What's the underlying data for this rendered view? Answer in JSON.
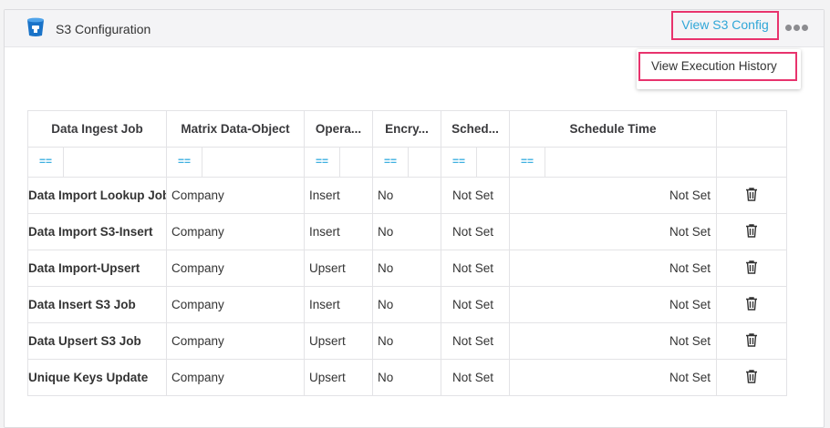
{
  "header": {
    "title": "S3 Configuration",
    "view_config_label": "View S3 Config"
  },
  "menu": {
    "items": [
      "View Execution History"
    ]
  },
  "table": {
    "columns": [
      "Data Ingest Job",
      "Matrix Data-Object",
      "Opera...",
      "Encry...",
      "Sched...",
      "Schedule Time",
      ""
    ],
    "filter_icon": "==",
    "rows": [
      [
        "Data Import Lookup Job",
        "Company",
        "Insert",
        "No",
        "Not Set",
        "Not Set"
      ],
      [
        "Data Import S3-Insert",
        "Company",
        "Insert",
        "No",
        "Not Set",
        "Not Set"
      ],
      [
        "Data Import-Upsert",
        "Company",
        "Upsert",
        "No",
        "Not Set",
        "Not Set"
      ],
      [
        "Data Insert S3 Job",
        "Company",
        "Insert",
        "No",
        "Not Set",
        "Not Set"
      ],
      [
        "Data Upsert S3 Job",
        "Company",
        "Upsert",
        "No",
        "Not Set",
        "Not Set"
      ],
      [
        "Unique Keys Update",
        "Company",
        "Upsert",
        "No",
        "Not Set",
        "Not Set"
      ]
    ]
  },
  "colors": {
    "accent": "#2fa6d7",
    "highlight": "#e8336d",
    "link": "#1f7fb5"
  },
  "icons": [
    "bucket-icon",
    "more-icon",
    "filter-icon",
    "trash-icon"
  ]
}
